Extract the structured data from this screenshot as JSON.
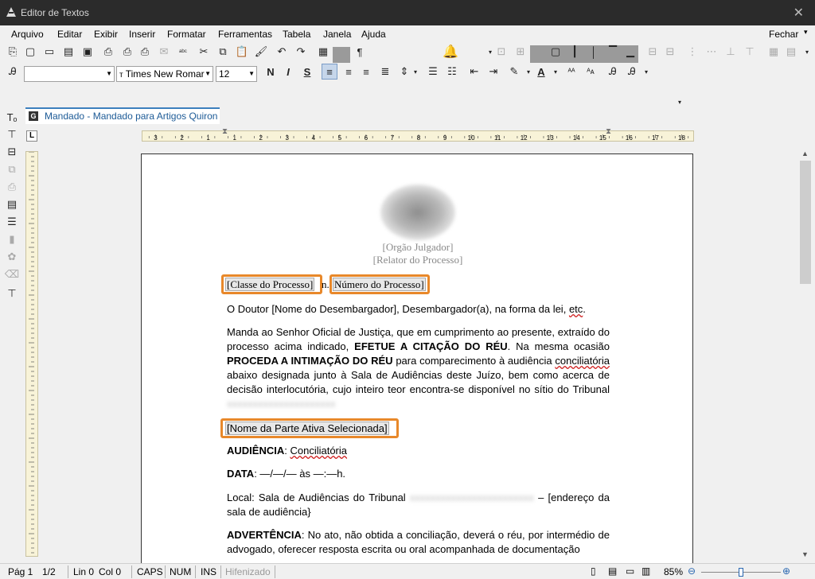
{
  "window": {
    "title": "Editor de Textos"
  },
  "menu": {
    "items": [
      "Arquivo",
      "Editar",
      "Exibir",
      "Inserir",
      "Formatar",
      "Ferramentas",
      "Tabela",
      "Janela",
      "Ajuda"
    ],
    "close": "Fechar"
  },
  "format": {
    "font": "Times New Romar",
    "size": "12"
  },
  "tab": {
    "label": "Mandado - Mandado para Artigos Quiron",
    "icon": "G"
  },
  "ruler": {
    "marks": [
      "3",
      "2",
      "1",
      "1",
      "2",
      "3",
      "4",
      "5",
      "6",
      "7",
      "8",
      "9",
      "10",
      "11",
      "12",
      "13",
      "14",
      "15",
      "16",
      "17",
      "18"
    ]
  },
  "document": {
    "org1": "[Orgão Julgador]",
    "org2": "[Relator do Processo]",
    "classe": "[Classe do Processo]",
    "numero": "Número do Processo]",
    "n_sep": "n.",
    "p1": "O Doutor [Nome do Desembargador], Desembargador(a), na forma da lei,",
    "p1_etc": "etc",
    "p2a": "Manda ao Senhor Oficial de Justiça, que em cumprimento ao presente, extraído do processo acima indicado,",
    "p2b": "EFETUE A CITAÇÃO DO RÉU",
    "p2c": ". Na mesma ocasião",
    "p2d": "PROCEDA A INTIMAÇÃO DO RÉU",
    "p2e": "para comparecimento à audiência",
    "p2f": "conciliatória",
    "p2g": "abaixo designada junto à Sala de Audiências deste Juízo, bem como acerca de decisão interlocutória, cujo inteiro teor encontra-se disponível no sítio do Tribunal",
    "parte": "[Nome da Parte Ativa Selecionada]",
    "aud_label": "AUDIÊNCIA",
    "aud_value": "Conciliatória",
    "data_label": "DATA",
    "data_value": ": —/—/— às —:—h.",
    "local_a": "Local: Sala de Audiências  do Tribunal",
    "local_b": "–",
    "local_c": "[endereço da sala de audiência}",
    "adv_label": "ADVERTÊNCIA",
    "adv_text": ": No ato, não obtida a conciliação, deverá o réu, por intermédio de advogado, oferecer resposta escrita ou oral acompanhada de documentação"
  },
  "status": {
    "page": "Pág 1",
    "pages": "1/2",
    "lin": "Lin 0",
    "col": "Col 0",
    "caps": "CAPS",
    "num": "NUM",
    "ins": "INS",
    "hif": "Hifenizado",
    "zoom": "85%"
  },
  "zoom_level": 0.5
}
